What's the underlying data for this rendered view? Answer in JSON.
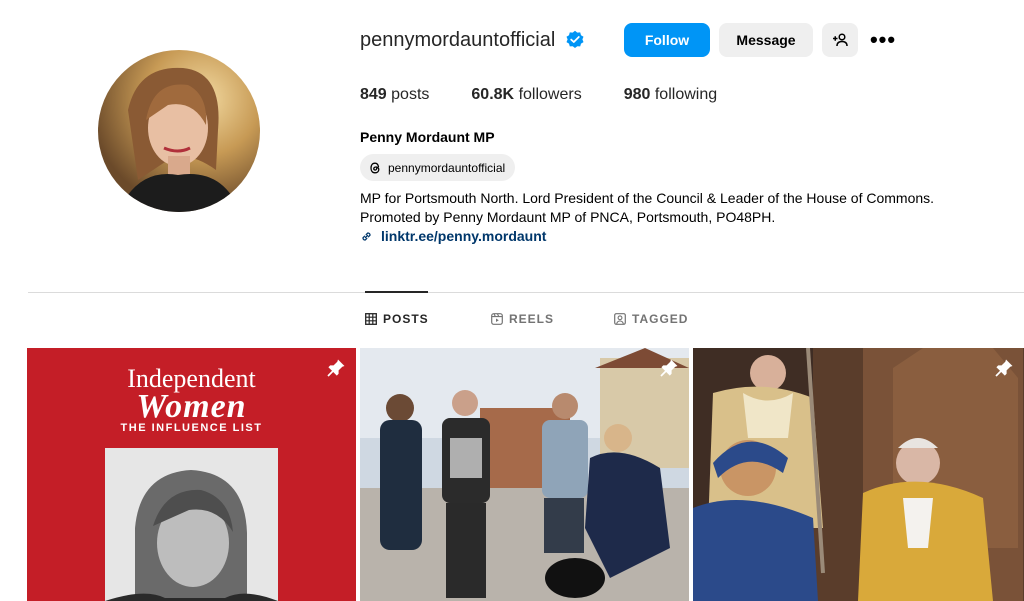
{
  "profile": {
    "username": "pennymordauntofficial",
    "verified": true,
    "full_name": "Penny Mordaunt MP",
    "threads_handle": "pennymordauntofficial",
    "bio_line1": "MP for Portsmouth North. Lord President of the Council & Leader of the House of Commons.",
    "bio_line2": "Promoted by Penny Mordaunt MP of PNCA, Portsmouth, PO48PH.",
    "link": "linktr.ee/penny.mordaunt"
  },
  "actions": {
    "follow_label": "Follow",
    "message_label": "Message",
    "add_user_icon": "person-add-icon",
    "more_label": "•••"
  },
  "stats": {
    "posts_count": "849",
    "posts_label": "posts",
    "followers_count": "60.8K",
    "followers_label": "followers",
    "following_count": "980",
    "following_label": "following"
  },
  "tabs": [
    {
      "label": "POSTS",
      "icon": "grid-icon",
      "active": true
    },
    {
      "label": "REELS",
      "icon": "reels-icon",
      "active": false
    },
    {
      "label": "TAGGED",
      "icon": "tagged-icon",
      "active": false
    }
  ],
  "posts": [
    {
      "pinned": true,
      "title_line1": "Independent",
      "title_line2": "Women",
      "subtitle": "THE INFLUENCE LIST"
    },
    {
      "pinned": true
    },
    {
      "pinned": true
    }
  ],
  "colors": {
    "accent": "#0095f6",
    "link": "#00376b",
    "verified": "#0095f6",
    "post1_bg": "#c41e27"
  }
}
